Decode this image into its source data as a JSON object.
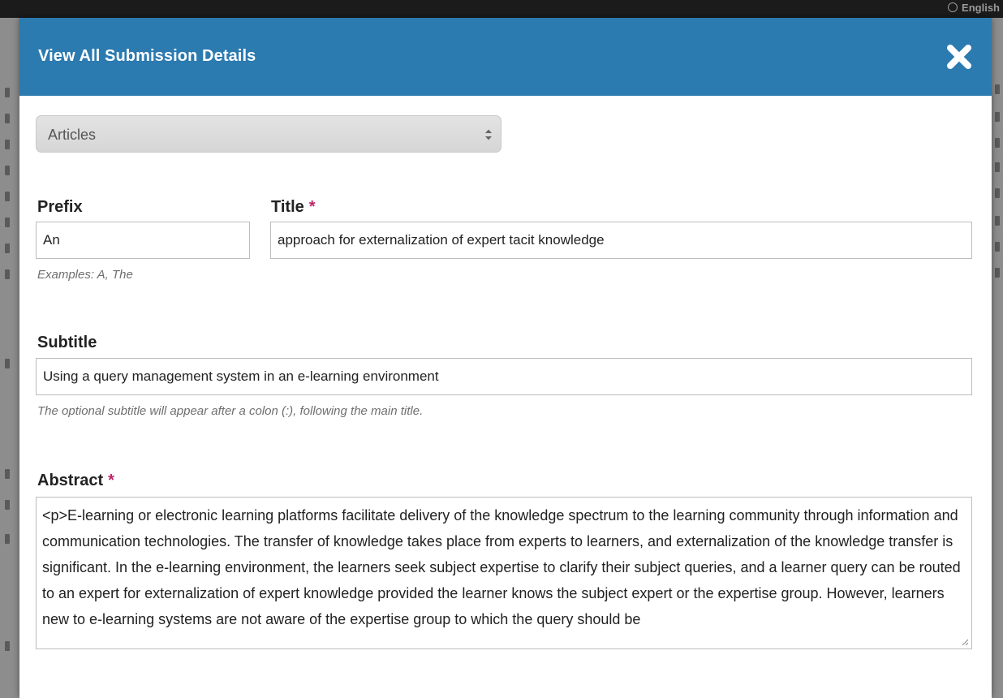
{
  "background": {
    "language_label": "English"
  },
  "modal": {
    "title": "View All Submission Details",
    "close_icon": "close-x-icon",
    "header_color": "#2b7ab0",
    "section_select": {
      "selected": "Articles"
    },
    "prefix": {
      "label": "Prefix",
      "value": "An",
      "hint": "Examples: A, The"
    },
    "title_field": {
      "label": "Title",
      "required_marker": "*",
      "value": "approach for externalization of expert tacit knowledge"
    },
    "subtitle": {
      "label": "Subtitle",
      "value": "Using a query management system in an e-learning environment",
      "hint": "The optional subtitle will appear after a colon (:), following the main title."
    },
    "abstract": {
      "label": "Abstract",
      "required_marker": "*",
      "value": "<p>E-learning or electronic learning platforms facilitate delivery of the knowledge spectrum to the learning community through information and communication technologies. The transfer of knowledge takes place from experts to learners, and externalization of the knowledge transfer is significant. In the e-learning environment, the learners seek subject expertise to clarify their subject queries, and a learner query can be routed to an expert for externalization of expert knowledge provided the learner knows the subject expert or the expertise group. However, learners new to e-learning systems are not aware of the expertise group to which the query should be"
    },
    "required_color": "#c0246a"
  }
}
